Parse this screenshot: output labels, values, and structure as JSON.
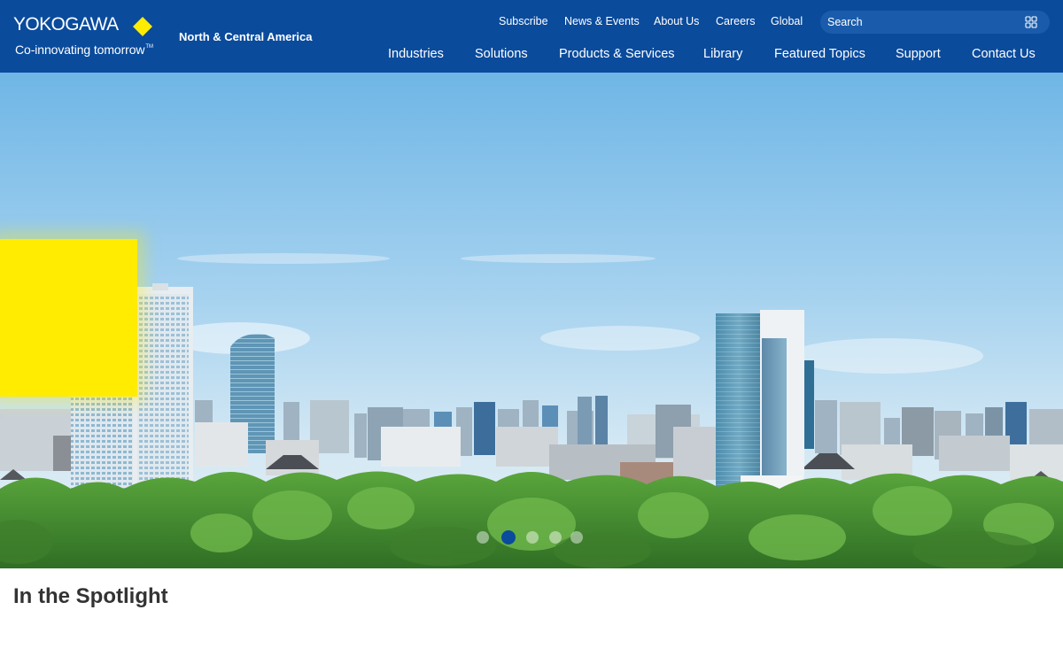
{
  "brand": {
    "name": "YOKOGAWA",
    "tagline": "Co-innovating tomorrow",
    "trademark": "TM",
    "region": "North & Central America",
    "accent_color": "#ffec00",
    "header_color": "#0a4b9c"
  },
  "utility_nav": [
    {
      "label": "Subscribe"
    },
    {
      "label": "News & Events"
    },
    {
      "label": "About Us"
    },
    {
      "label": "Careers"
    },
    {
      "label": "Global"
    }
  ],
  "search": {
    "placeholder": "Search",
    "icon": "grid-icon"
  },
  "main_nav": [
    {
      "label": "Industries"
    },
    {
      "label": "Solutions"
    },
    {
      "label": "Products & Services"
    },
    {
      "label": "Library"
    },
    {
      "label": "Featured Topics"
    },
    {
      "label": "Support"
    },
    {
      "label": "Contact Us"
    }
  ],
  "hero": {
    "slide_count": 5,
    "active_slide": 2,
    "image": "city-skyline-with-trees"
  },
  "spotlight": {
    "title": "In the Spotlight"
  }
}
